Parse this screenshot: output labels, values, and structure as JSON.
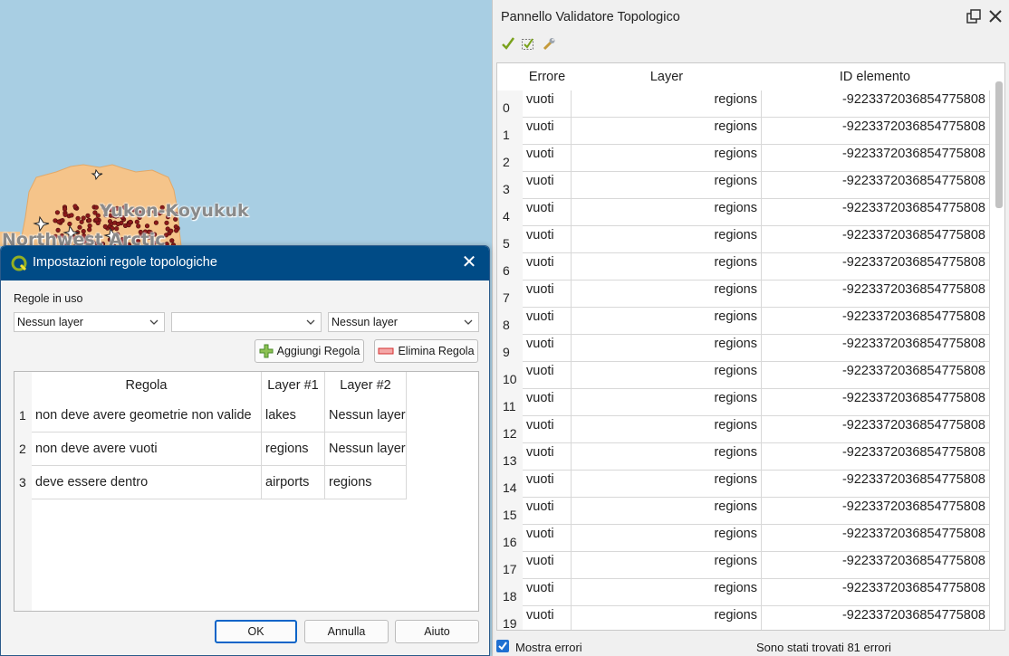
{
  "map": {
    "labels": [
      "Yukon-Koyukuk",
      "Northwest Arctic"
    ]
  },
  "topology_panel": {
    "title": "Pannello Validatore Topologico",
    "columns": [
      "Errore",
      "Layer",
      "ID elemento"
    ],
    "rows": [
      {
        "num": "0",
        "error": "vuoti",
        "layer": "regions",
        "id": "-9223372036854775808"
      },
      {
        "num": "1",
        "error": "vuoti",
        "layer": "regions",
        "id": "-9223372036854775808"
      },
      {
        "num": "2",
        "error": "vuoti",
        "layer": "regions",
        "id": "-9223372036854775808"
      },
      {
        "num": "3",
        "error": "vuoti",
        "layer": "regions",
        "id": "-9223372036854775808"
      },
      {
        "num": "4",
        "error": "vuoti",
        "layer": "regions",
        "id": "-9223372036854775808"
      },
      {
        "num": "5",
        "error": "vuoti",
        "layer": "regions",
        "id": "-9223372036854775808"
      },
      {
        "num": "6",
        "error": "vuoti",
        "layer": "regions",
        "id": "-9223372036854775808"
      },
      {
        "num": "7",
        "error": "vuoti",
        "layer": "regions",
        "id": "-9223372036854775808"
      },
      {
        "num": "8",
        "error": "vuoti",
        "layer": "regions",
        "id": "-9223372036854775808"
      },
      {
        "num": "9",
        "error": "vuoti",
        "layer": "regions",
        "id": "-9223372036854775808"
      },
      {
        "num": "10",
        "error": "vuoti",
        "layer": "regions",
        "id": "-9223372036854775808"
      },
      {
        "num": "11",
        "error": "vuoti",
        "layer": "regions",
        "id": "-9223372036854775808"
      },
      {
        "num": "12",
        "error": "vuoti",
        "layer": "regions",
        "id": "-9223372036854775808"
      },
      {
        "num": "13",
        "error": "vuoti",
        "layer": "regions",
        "id": "-9223372036854775808"
      },
      {
        "num": "14",
        "error": "vuoti",
        "layer": "regions",
        "id": "-9223372036854775808"
      },
      {
        "num": "15",
        "error": "vuoti",
        "layer": "regions",
        "id": "-9223372036854775808"
      },
      {
        "num": "16",
        "error": "vuoti",
        "layer": "regions",
        "id": "-9223372036854775808"
      },
      {
        "num": "17",
        "error": "vuoti",
        "layer": "regions",
        "id": "-9223372036854775808"
      },
      {
        "num": "18",
        "error": "vuoti",
        "layer": "regions",
        "id": "-9223372036854775808"
      },
      {
        "num": "19",
        "error": "vuoti",
        "layer": "regions",
        "id": "-9223372036854775808"
      }
    ],
    "show_errors_label": "Mostra errori",
    "show_errors_checked": true,
    "status": "Sono stati trovati 81 errori",
    "toolbar_icons": [
      "validate-all-icon",
      "validate-extent-icon",
      "configure-rules-icon"
    ]
  },
  "dialog": {
    "title": "Impostazioni regole topologiche",
    "rules_label": "Regole in uso",
    "combo1": "Nessun layer",
    "combo2": "",
    "combo3": "Nessun layer",
    "add_rule": "Aggiungi Regola",
    "delete_rule": "Elimina Regola",
    "columns": [
      "Regola",
      "Layer #1",
      "Layer #2"
    ],
    "rules": [
      {
        "num": "1",
        "rule": "non deve avere geometrie non valide",
        "layer1": "lakes",
        "layer2": "Nessun layer"
      },
      {
        "num": "2",
        "rule": "non deve avere vuoti",
        "layer1": "regions",
        "layer2": "Nessun layer"
      },
      {
        "num": "3",
        "rule": "deve essere dentro",
        "layer1": "airports",
        "layer2": "regions"
      }
    ],
    "ok": "OK",
    "cancel": "Annulla",
    "help": "Aiuto"
  },
  "colors": {
    "accent": "#004b86",
    "map_water": "#a8cee3",
    "map_land": "#f5c48a",
    "checkbox": "#1f6fd1"
  }
}
